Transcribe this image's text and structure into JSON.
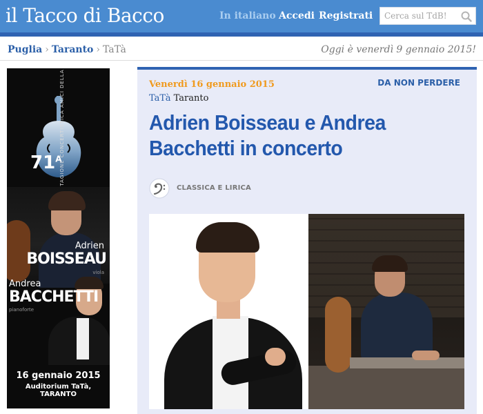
{
  "header": {
    "logo": "il Tacco di Bacco",
    "nav": {
      "italian": "In italiano",
      "login": "Accedi",
      "register": "Registrati"
    },
    "search": {
      "placeholder": "Cerca sul TdB!",
      "icon": "search-icon"
    },
    "colors": {
      "bar": "#4a8bd0",
      "bar_border": "#2f63b2"
    }
  },
  "breadcrumb": {
    "items": [
      "Puglia",
      "Taranto"
    ],
    "separator": "›",
    "current": "TaTà"
  },
  "today": "Oggi è venerdì 9 gennaio 2015!",
  "sidebar_ad": {
    "season_number": "71",
    "season_suffix": "A",
    "season_text": "STAGIONE CONCERTISTICA AMICI DELLA MUSICA",
    "artist1_first": "Adrien",
    "artist1_last": "BOISSEAU",
    "artist1_role": "viola",
    "artist2_first": "Andrea",
    "artist2_last": "BACCHETTI",
    "artist2_role": "pianoforte",
    "date": "16 gennaio 2015",
    "venue": "Auditorium TaTà, TARANTO"
  },
  "event": {
    "date": "Venerdì 16 gennaio 2015",
    "badge": "DA NON PERDERE",
    "venue_name": "TaTà",
    "venue_city": "Taranto",
    "title": "Adrien Boisseau e Andrea Bacchetti in concerto",
    "genre": "CLASSICA E LIRICA",
    "genre_icon": "bass-clef-icon",
    "colors": {
      "date": "#f09a1e",
      "title": "#2358ad",
      "card_bg": "#e8ebf8"
    }
  }
}
